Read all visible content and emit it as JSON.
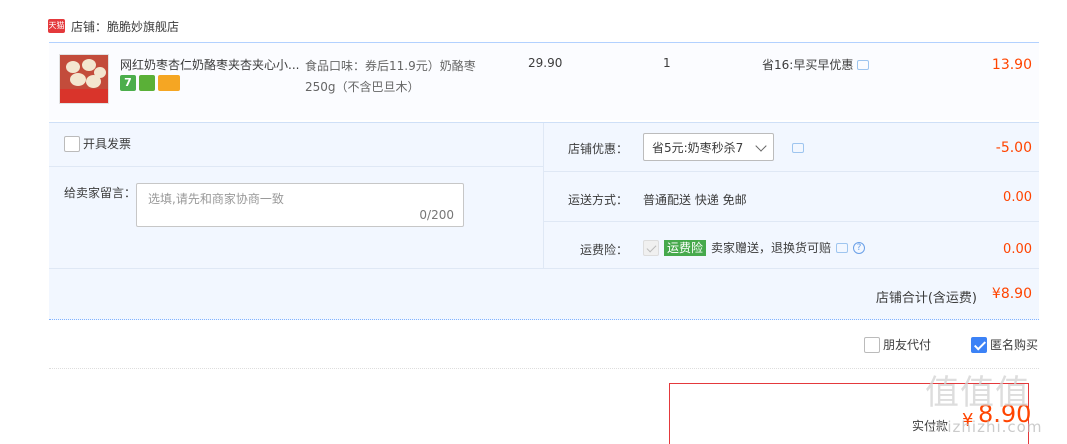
{
  "store": {
    "badge": "天猫",
    "label": "店铺：脆脆妙旗舰店"
  },
  "product": {
    "title": "网红奶枣杏仁奶酪枣夹杏夹心小...",
    "badges": [
      "7",
      "",
      ""
    ],
    "spec": "食品口味：券后11.9元）奶酪枣250g（不含巴旦木）",
    "price": "29.90",
    "quantity": "1",
    "promo": "省16:早买早优惠",
    "subtotal": "13.90"
  },
  "options": {
    "invoice_label": "开具发票",
    "message_label": "给卖家留言：",
    "message_placeholder": "选填,请先和商家协商一致",
    "message_count": "0/200",
    "discount_label": "店铺优惠：",
    "discount_selected": "省5元:奶枣秒杀7",
    "discount_amount": "-5.00",
    "shipping_label": "运送方式：",
    "shipping_value": "普通配送 快递 免邮",
    "shipping_amount": "0.00",
    "insurance_label": "运费险：",
    "insurance_tag": "运费险",
    "insurance_text": "卖家赠送，退换货可赔",
    "insurance_amount": "0.00"
  },
  "totals": {
    "store_total_label": "店铺合计(含运费)",
    "store_total_amount": "¥8.90"
  },
  "checkout": {
    "friend_pay_label": "朋友代付",
    "friend_pay_checked": false,
    "anonymous_label": "匿名购买",
    "anonymous_checked": true,
    "pay_label": "实付款",
    "pay_currency": "¥",
    "pay_amount": "8.90"
  },
  "watermark": {
    "main": "值值值",
    "sub": "zhizhizhi.com"
  },
  "colors": {
    "price_red": "#ff4400",
    "accent_blue": "#3c82f6",
    "panel_bg": "#f2f7ff",
    "insurance_green": "#46a94c"
  },
  "icons": [
    "tmall-icon",
    "chat-icon",
    "chevron-down-icon",
    "help-icon"
  ]
}
